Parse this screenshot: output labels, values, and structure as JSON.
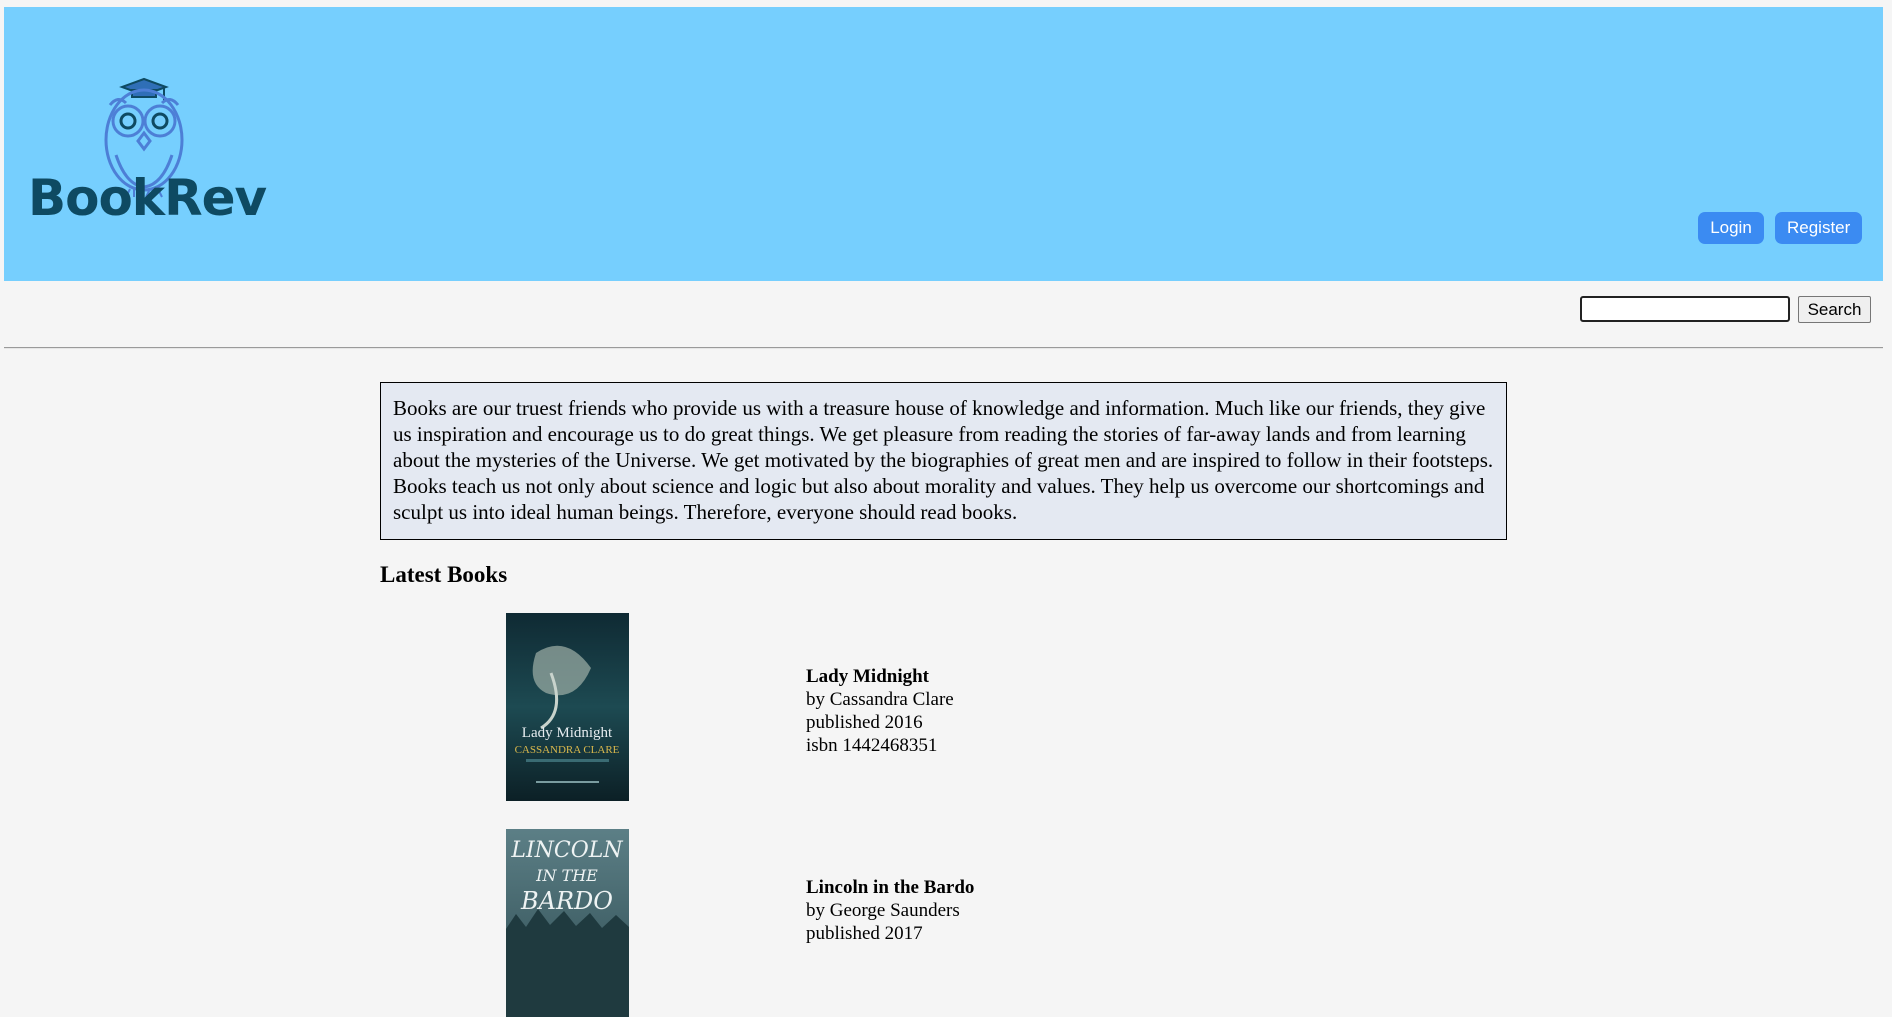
{
  "header": {
    "logo_text": "BookRev",
    "login_label": "Login",
    "register_label": "Register",
    "background_color": "#76cffe",
    "button_color": "#3b8bf2"
  },
  "search": {
    "value": "",
    "placeholder": "",
    "button_label": "Search"
  },
  "intro_text": "Books are our truest friends who provide us with a treasure house of knowledge and information. Much like our friends, they give us inspiration and encourage us to do great things. We get pleasure from reading the stories of far-away lands and from learning about the mysteries of the Universe. We get motivated by the biographies of great men and are inspired to follow in their footsteps. Books teach us not only about science and logic but also about morality and values. They help us overcome our shortcomings and sculpt us into ideal human beings. Therefore, everyone should read books.",
  "latest_books": {
    "heading": "Latest Books",
    "books": [
      {
        "title": "Lady Midnight",
        "author": "by Cassandra Clare",
        "published": "published 2016",
        "isbn": "isbn 1442468351",
        "cover_title": "Lady Midnight",
        "cover_author": "CASSANDRA CLARE"
      },
      {
        "title": "Lincoln in the Bardo",
        "author": "by George Saunders",
        "published": "published 2017",
        "cover_title_line1": "LINCOLN",
        "cover_title_line2": "IN THE",
        "cover_title_line3": "BARDO"
      }
    ]
  }
}
